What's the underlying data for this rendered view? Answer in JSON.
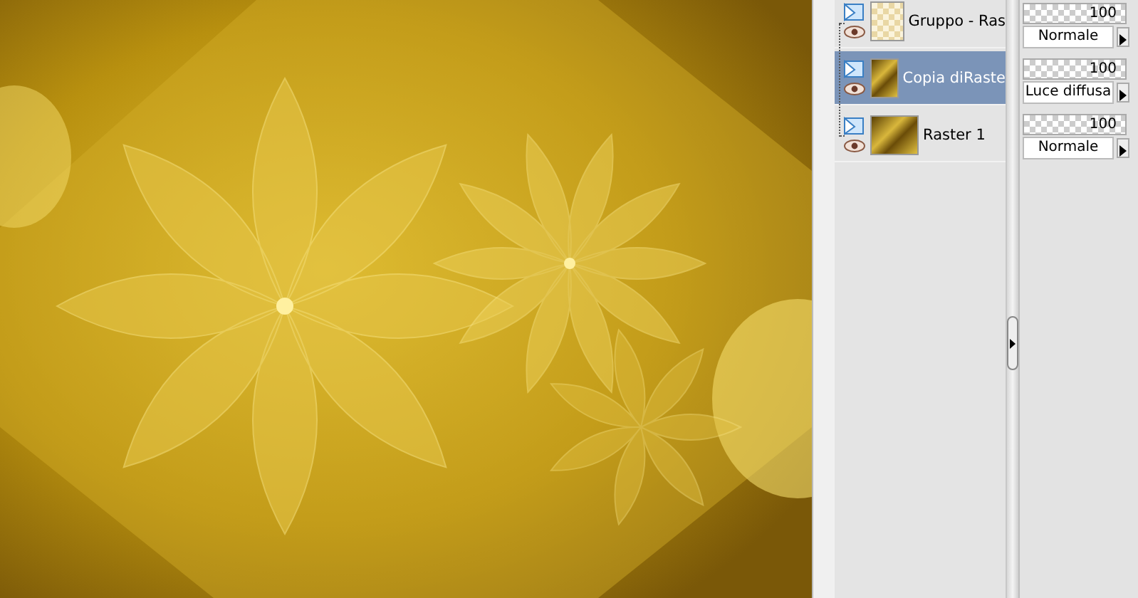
{
  "layers": [
    {
      "name": "Gruppo - Ras",
      "kind": "group",
      "selected": false,
      "opacity": "100",
      "blend_mode": "Normale"
    },
    {
      "name": "Copia diRaste",
      "kind": "raster",
      "selected": true,
      "opacity": "100",
      "blend_mode": "Luce diffusa"
    },
    {
      "name": "Raster 1",
      "kind": "raster",
      "selected": false,
      "opacity": "100",
      "blend_mode": "Normale"
    }
  ]
}
